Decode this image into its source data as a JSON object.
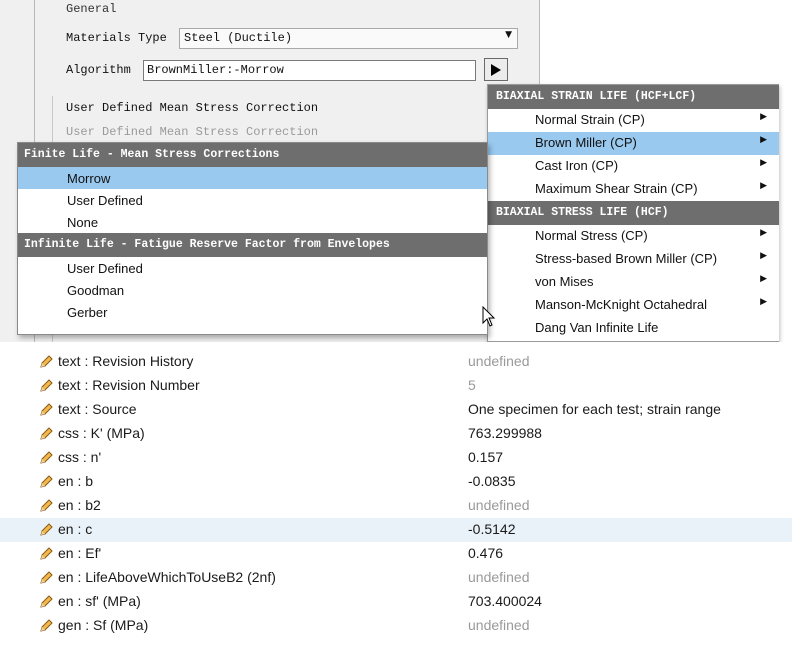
{
  "dialog": {
    "general_label": "General",
    "materials_type_label": "Materials Type",
    "materials_type_value": "Steel (Ductile)",
    "algorithm_label": "Algorithm",
    "algorithm_value": "BrownMiller:-Morrow",
    "udm_label_1": "User Defined Mean Stress Correction",
    "udm_label_2": "User Defined Mean Stress Correction"
  },
  "right_menu": {
    "sections": [
      {
        "header": "BIAXIAL STRAIN LIFE (HCF+LCF)",
        "items": [
          {
            "label": "Normal Strain (CP)",
            "submenu": true,
            "selected": false
          },
          {
            "label": "Brown Miller (CP)",
            "submenu": true,
            "selected": true
          },
          {
            "label": "Cast Iron (CP)",
            "submenu": true,
            "selected": false
          },
          {
            "label": "Maximum Shear Strain (CP)",
            "submenu": true,
            "selected": false
          }
        ]
      },
      {
        "header": "BIAXIAL STRESS LIFE (HCF)",
        "items": [
          {
            "label": "Normal Stress (CP)",
            "submenu": true,
            "selected": false
          },
          {
            "label": "Stress-based Brown Miller (CP)",
            "submenu": true,
            "selected": false
          },
          {
            "label": "von Mises",
            "submenu": true,
            "selected": false
          },
          {
            "label": "Manson-McKnight Octahedral",
            "submenu": true,
            "selected": false
          },
          {
            "label": "Dang Van Infinite Life",
            "submenu": false,
            "selected": false
          }
        ]
      }
    ]
  },
  "left_menu": {
    "sections": [
      {
        "header": "Finite Life - Mean Stress Corrections",
        "items": [
          {
            "label": "Morrow",
            "selected": true
          },
          {
            "label": "User Defined",
            "selected": false
          },
          {
            "label": "None",
            "selected": false
          }
        ]
      },
      {
        "header": "Infinite Life - Fatigue Reserve Factor from Envelopes",
        "items": [
          {
            "label": "User Defined",
            "selected": false
          },
          {
            "label": "Goodman",
            "selected": false
          },
          {
            "label": "Gerber",
            "selected": false
          }
        ]
      }
    ]
  },
  "properties": [
    {
      "name": "text : Revision History",
      "value": "undefined",
      "undefined": true,
      "highlight": false
    },
    {
      "name": "text : Revision Number",
      "value": "5",
      "undefined": true,
      "highlight": false
    },
    {
      "name": "text : Source",
      "value": "One specimen for each test; strain range",
      "undefined": false,
      "highlight": false
    },
    {
      "name": "css : K' (MPa)",
      "value": "763.299988",
      "undefined": false,
      "highlight": false
    },
    {
      "name": "css : n'",
      "value": "0.157",
      "undefined": false,
      "highlight": false
    },
    {
      "name": "en : b",
      "value": "-0.0835",
      "undefined": false,
      "highlight": false
    },
    {
      "name": "en : b2",
      "value": "undefined",
      "undefined": true,
      "highlight": false
    },
    {
      "name": "en : c",
      "value": "-0.5142",
      "undefined": false,
      "highlight": true
    },
    {
      "name": "en : Ef'",
      "value": "0.476",
      "undefined": false,
      "highlight": false
    },
    {
      "name": "en : LifeAboveWhichToUseB2 (2nf)",
      "value": "undefined",
      "undefined": true,
      "highlight": false
    },
    {
      "name": "en : sf' (MPa)",
      "value": "703.400024",
      "undefined": false,
      "highlight": false
    },
    {
      "name": "gen : Sf (MPa)",
      "value": "undefined",
      "undefined": true,
      "highlight": false
    }
  ],
  "colors": {
    "menu_header": "#6e6e6e",
    "selection": "#99c9ef",
    "row_highlight": "#eaf2f9",
    "undefined_text": "#9a9a9a"
  },
  "icons": {
    "property_edit": "pencil-icon",
    "algorithm_picker": "play-arrow-icon",
    "dropdown": "chevron-down-icon",
    "submenu": "submenu-arrow-icon",
    "cursor": "mouse-cursor-icon"
  }
}
